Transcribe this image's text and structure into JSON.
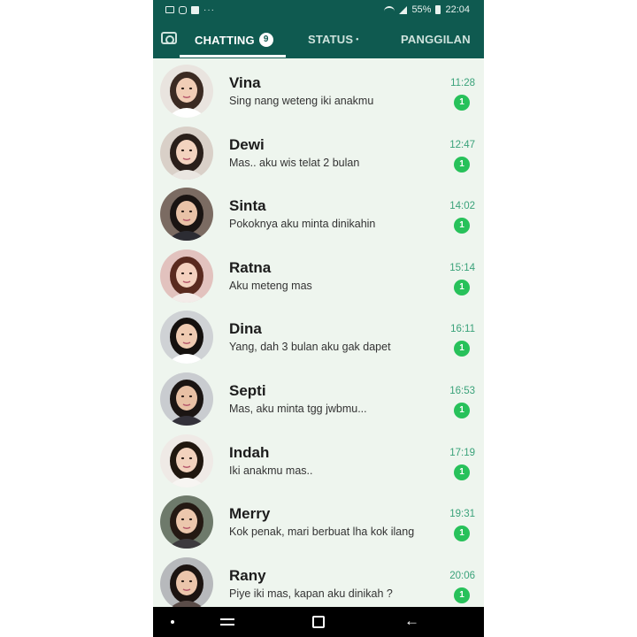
{
  "status_bar": {
    "battery": "55%",
    "time": "22:04",
    "icons": [
      "message-icon",
      "instagram-icon",
      "facebook-icon",
      "more-dots-icon",
      "wifi-icon",
      "signal-icon",
      "battery-icon"
    ]
  },
  "tabs": {
    "camera_icon": "camera-icon",
    "chatting": {
      "label": "CHATTING",
      "badge": "9"
    },
    "status": {
      "label": "STATUS",
      "dot": "•"
    },
    "panggilan": {
      "label": "PANGGILAN"
    }
  },
  "colors": {
    "header": "#0f5a50",
    "accent": "#27c15a",
    "time": "#3aa27a",
    "list_background": "#eef5ee"
  },
  "chats": [
    {
      "name": "Vina",
      "message": "Sing nang weteng iki anakmu",
      "time": "11:28",
      "unread": "1"
    },
    {
      "name": "Dewi",
      "message": "Mas.. aku wis telat 2 bulan",
      "time": "12:47",
      "unread": "1"
    },
    {
      "name": "Sinta",
      "message": "Pokoknya aku minta dinikahin",
      "time": "14:02",
      "unread": "1"
    },
    {
      "name": "Ratna",
      "message": "Aku meteng mas",
      "time": "15:14",
      "unread": "1"
    },
    {
      "name": "Dina",
      "message": "Yang, dah 3 bulan aku gak dapet",
      "time": "16:11",
      "unread": "1"
    },
    {
      "name": "Septi",
      "message": "Mas, aku minta tgg jwbmu...",
      "time": "16:53",
      "unread": "1"
    },
    {
      "name": "Indah",
      "message": "Iki anakmu mas..",
      "time": "17:19",
      "unread": "1"
    },
    {
      "name": "Merry",
      "message": "Kok penak, mari berbuat lha kok ilang",
      "time": "19:31",
      "unread": "1"
    },
    {
      "name": "Rany",
      "message": "Piye iki mas, kapan aku dinikah ?",
      "time": "20:06",
      "unread": "1"
    }
  ],
  "nav_bar": {
    "icons": [
      "nav-dot-icon",
      "recent-apps-icon",
      "home-icon",
      "back-icon"
    ]
  }
}
